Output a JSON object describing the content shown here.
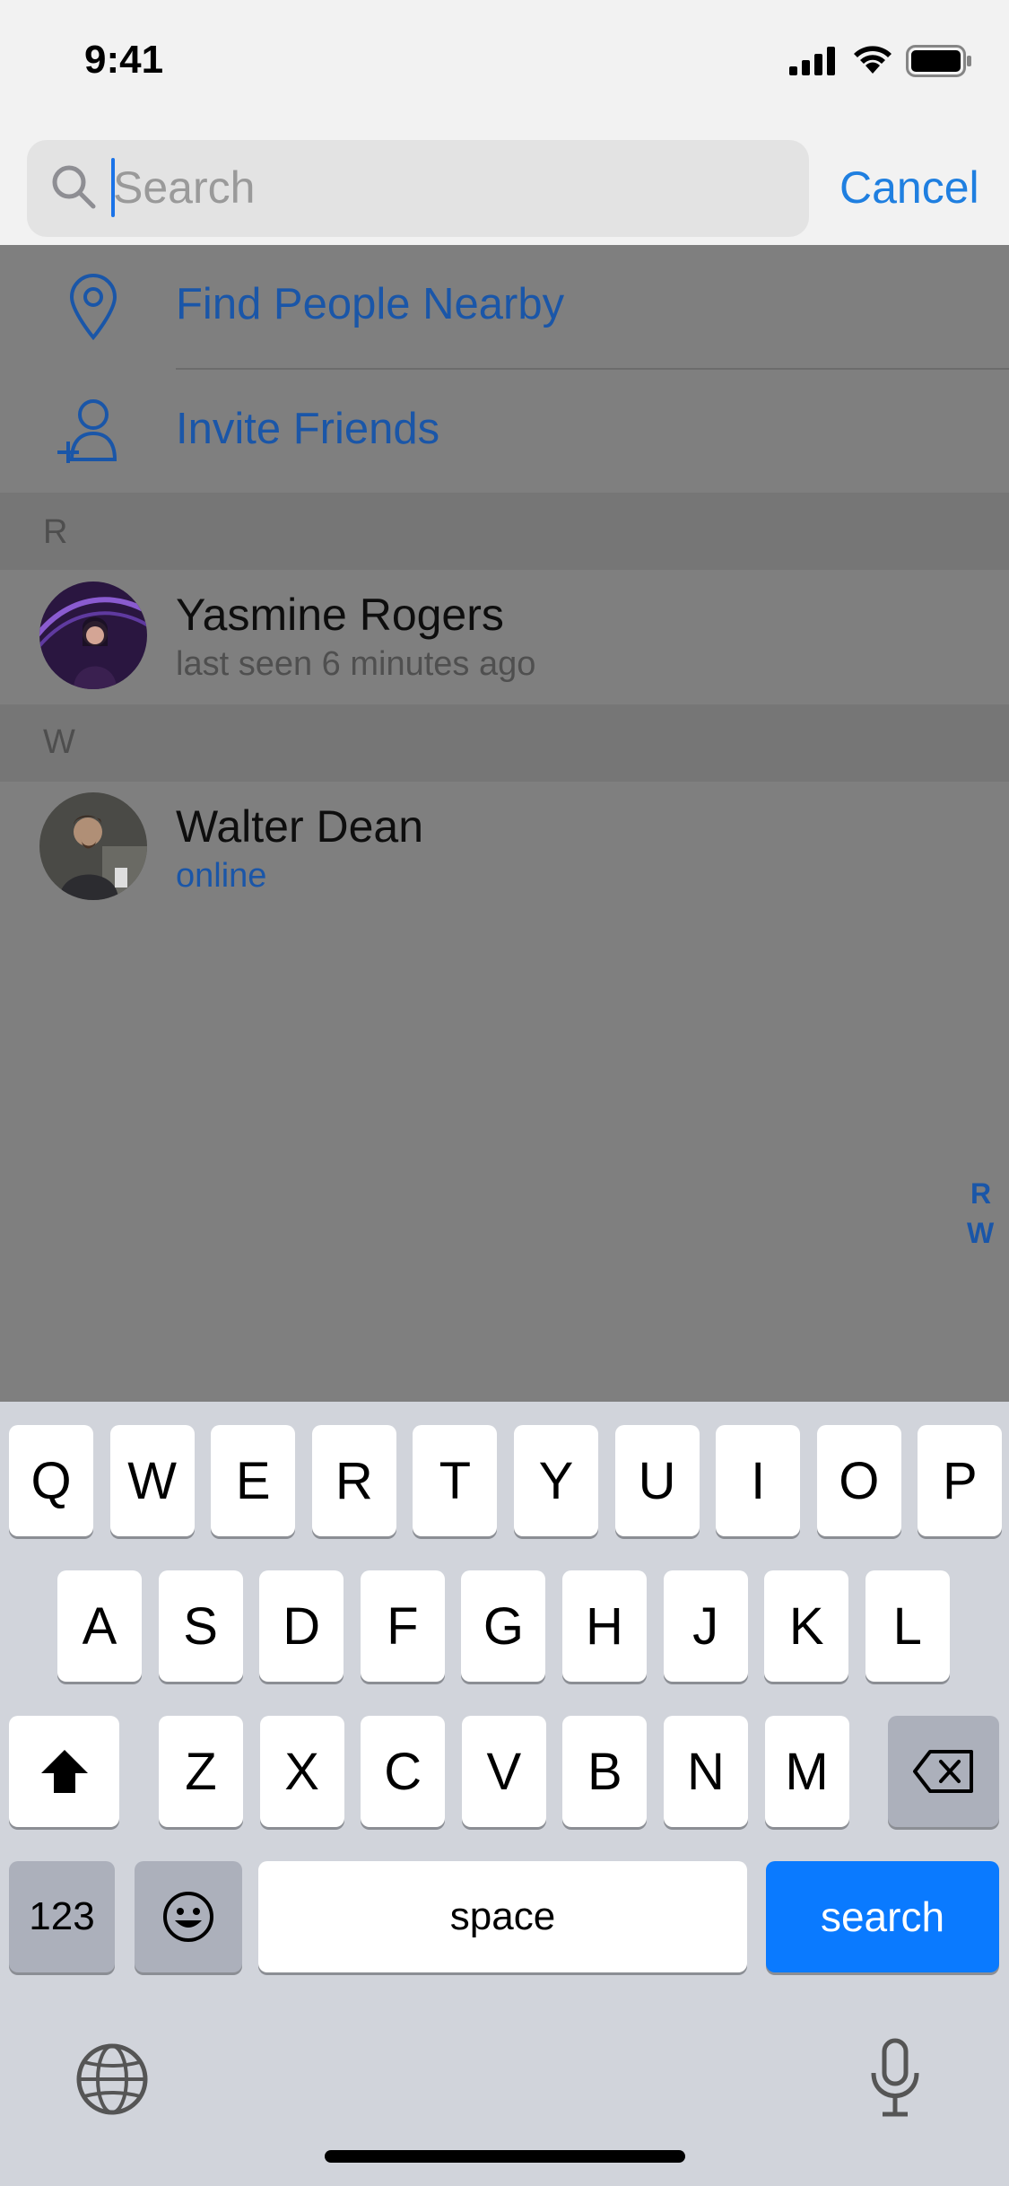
{
  "status_bar": {
    "time": "9:41"
  },
  "search": {
    "placeholder": "Search",
    "cancel_label": "Cancel"
  },
  "actions": [
    {
      "label": "Find People Nearby",
      "icon": "location-pin-icon"
    },
    {
      "label": "Invite Friends",
      "icon": "add-person-icon"
    }
  ],
  "sections": [
    {
      "letter": "R",
      "contacts": [
        {
          "name": "Yasmine Rogers",
          "status": "last seen 6 minutes ago",
          "online": false
        }
      ]
    },
    {
      "letter": "W",
      "contacts": [
        {
          "name": "Walter Dean",
          "status": "online",
          "online": true
        }
      ]
    }
  ],
  "index": [
    "R",
    "W"
  ],
  "keyboard": {
    "row1": [
      "Q",
      "W",
      "E",
      "R",
      "T",
      "Y",
      "U",
      "I",
      "O",
      "P"
    ],
    "row2": [
      "A",
      "S",
      "D",
      "F",
      "G",
      "H",
      "J",
      "K",
      "L"
    ],
    "row3": [
      "Z",
      "X",
      "C",
      "V",
      "B",
      "N",
      "M"
    ],
    "numbers_label": "123",
    "space_label": "space",
    "return_label": "search"
  },
  "colors": {
    "accent": "#1f7fe0",
    "keyboard_bg": "#d1d4db",
    "search_key": "#0a7aff",
    "overlay": "#7f7f7f"
  }
}
